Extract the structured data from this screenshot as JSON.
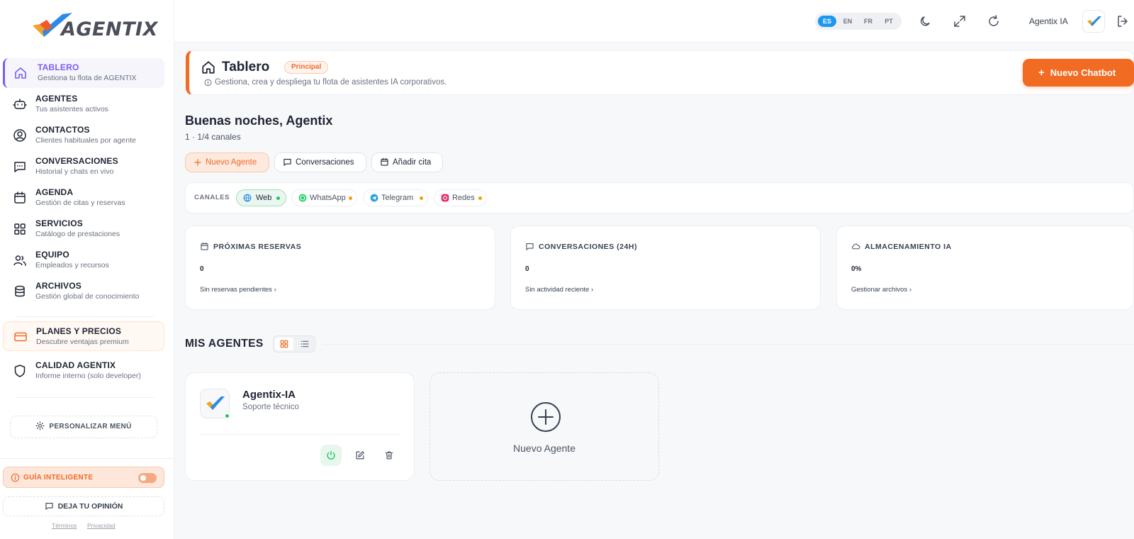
{
  "brand": {
    "name": "AGENTIX"
  },
  "sidebar": {
    "items": [
      {
        "title": "TABLERO",
        "subtitle": "Gestiona tu flota de AGENTIX",
        "icon": "home-icon"
      },
      {
        "title": "AGENTES",
        "subtitle": "Tus asistentes activos",
        "icon": "bot-icon"
      },
      {
        "title": "CONTACTOS",
        "subtitle": "Clientes habituales por agente",
        "icon": "user-circle-icon"
      },
      {
        "title": "CONVERSACIONES",
        "subtitle": "Historial y chats en vivo",
        "icon": "message-dots-icon"
      },
      {
        "title": "AGENDA",
        "subtitle": "Gestión de citas y reservas",
        "icon": "calendar-icon"
      },
      {
        "title": "SERVICIOS",
        "subtitle": "Catálogo de prestaciones",
        "icon": "grid-icon"
      },
      {
        "title": "EQUIPO",
        "subtitle": "Empleados y recursos",
        "icon": "users-icon"
      },
      {
        "title": "ARCHIVOS",
        "subtitle": "Gestión global de conocimiento",
        "icon": "database-icon"
      },
      {
        "title": "PLANES Y PRECIOS",
        "subtitle": "Descubre ventajas premium",
        "icon": "credit-card-icon"
      },
      {
        "title": "CALIDAD AGENTIX",
        "subtitle": "Informe interno (solo developer)",
        "icon": "shield-icon"
      }
    ],
    "customize_label": "PERSONALIZAR MENÚ",
    "guide_label": "GUÍA INTELIGENTE",
    "feedback_label": "DEJA TU OPINIÓN",
    "terms": "Términos",
    "privacy": "Privacidad"
  },
  "topbar": {
    "languages": [
      "ES",
      "EN",
      "FR",
      "PT"
    ],
    "active_language": "ES",
    "user_name": "Agentix IA"
  },
  "header": {
    "title": "Tablero",
    "badge": "Principal",
    "subtitle": "Gestiona, crea y despliega tu flota de asistentes IA corporativos.",
    "cta_label": "Nuevo Chatbot"
  },
  "greeting": {
    "title": "Buenas noches, Agentix",
    "subtitle": "1 · 1/4 canales"
  },
  "quick_actions": {
    "new_agent": "Nuevo Agente",
    "conversations": "Conversaciones",
    "add_appointment": "Añadir cita"
  },
  "channels": {
    "label": "CANALES",
    "items": [
      {
        "name": "Web",
        "status": "active",
        "dot_color": "#22c55e"
      },
      {
        "name": "WhatsApp",
        "status": "pending",
        "dot_color": "#f59e0b"
      },
      {
        "name": "Telegram",
        "status": "pending",
        "dot_color": "#f59e0b"
      },
      {
        "name": "Redes",
        "status": "pending",
        "dot_color": "#f59e0b"
      }
    ]
  },
  "stats": [
    {
      "title": "PRÓXIMAS RESERVAS",
      "value": "0",
      "link": "Sin reservas pendientes"
    },
    {
      "title": "CONVERSACIONES (24H)",
      "value": "0",
      "link": "Sin actividad reciente"
    },
    {
      "title": "ALMACENAMIENTO IA",
      "value": "0%",
      "link": "Gestionar archivos"
    }
  ],
  "agents_section": {
    "title": "MIS AGENTES",
    "agents": [
      {
        "name": "Agentix-IA",
        "role": "Soporte técnico",
        "online": true
      }
    ],
    "new_agent_label": "Nuevo Agente"
  },
  "colors": {
    "accent": "#f26b23",
    "active_nav": "#7c5cf2",
    "language_active": "#1d98f0",
    "online": "#22c55e"
  }
}
